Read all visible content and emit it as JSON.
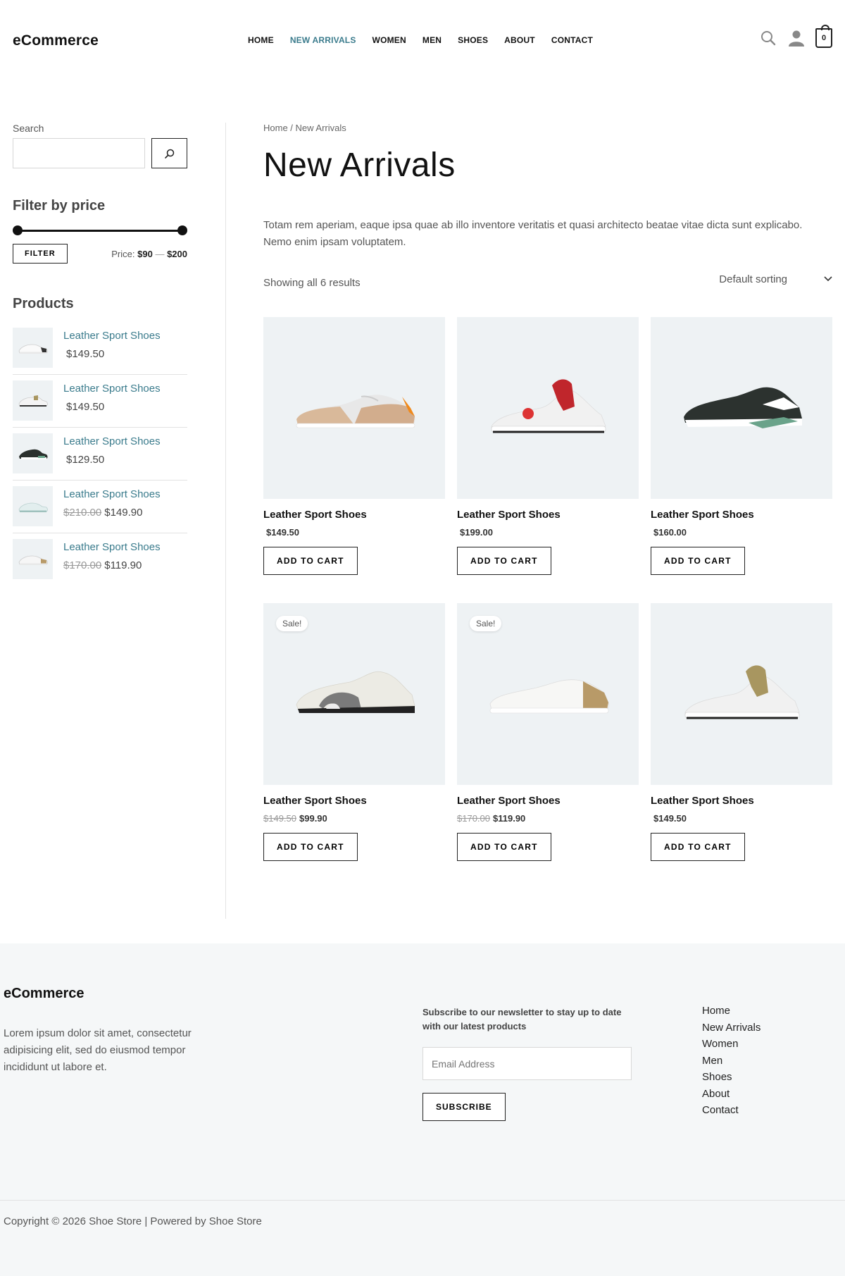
{
  "header": {
    "logo": "eCommerce",
    "nav": [
      "HOME",
      "NEW ARRIVALS",
      "WOMEN",
      "MEN",
      "SHOES",
      "ABOUT",
      "CONTACT"
    ],
    "active_nav": "NEW ARRIVALS",
    "cart_count": "0",
    "icons": [
      "search-icon",
      "user-icon",
      "cart-icon"
    ]
  },
  "sidebar": {
    "search_label": "Search",
    "search_value": "",
    "filter_title": "Filter by price",
    "filter_button": "FILTER",
    "price_prefix": "Price:",
    "price_min": "$90",
    "price_sep": "—",
    "price_max": "$200",
    "products_title": "Products",
    "products": [
      {
        "name": "Leather Sport Shoes",
        "old_price": "",
        "price": "$149.50"
      },
      {
        "name": "Leather Sport Shoes",
        "old_price": "",
        "price": "$149.50"
      },
      {
        "name": "Leather Sport Shoes",
        "old_price": "",
        "price": "$129.50"
      },
      {
        "name": "Leather Sport Shoes",
        "old_price": "$210.00",
        "price": "$149.90"
      },
      {
        "name": "Leather Sport Shoes",
        "old_price": "$170.00",
        "price": "$119.90"
      }
    ]
  },
  "main": {
    "breadcrumb": "Home / New Arrivals",
    "title": "New Arrivals",
    "description": "Totam rem aperiam, eaque ipsa quae ab illo inventore veritatis et quasi architecto beatae vitae dicta sunt explicabo. Nemo enim ipsam voluptatem.",
    "results": "Showing all 6 results",
    "sorting": "Default sorting",
    "add_to_cart": "ADD TO CART",
    "sale_label": "Sale!",
    "products": [
      {
        "name": "Leather Sport Shoes",
        "old_price": "",
        "price": "$149.50",
        "sale": false
      },
      {
        "name": "Leather Sport Shoes",
        "old_price": "",
        "price": "$199.00",
        "sale": false
      },
      {
        "name": "Leather Sport Shoes",
        "old_price": "",
        "price": "$160.00",
        "sale": false
      },
      {
        "name": "Leather Sport Shoes",
        "old_price": "$149.50",
        "price": "$99.90",
        "sale": true
      },
      {
        "name": "Leather Sport Shoes",
        "old_price": "$170.00",
        "price": "$119.90",
        "sale": true
      },
      {
        "name": "Leather Sport Shoes",
        "old_price": "",
        "price": "$149.50",
        "sale": false
      }
    ]
  },
  "footer": {
    "logo": "eCommerce",
    "description": "Lorem ipsum dolor sit amet, consectetur adipisicing elit, sed do eiusmod tempor incididunt ut labore et.",
    "newsletter": "Subscribe to our newsletter to stay up to date with our latest products",
    "email_placeholder": "Email Address",
    "subscribe": "SUBSCRIBE",
    "links": [
      "Home",
      "New Arrivals",
      "Women",
      "Men",
      "Shoes",
      "About",
      "Contact"
    ],
    "copyright": "Copyright © 2026 Shoe Store | Powered by Shoe Store"
  },
  "colors": {
    "accent": "#3a7b8c",
    "product_bg": "#eef2f4",
    "footer_bg": "#f5f7f8"
  }
}
